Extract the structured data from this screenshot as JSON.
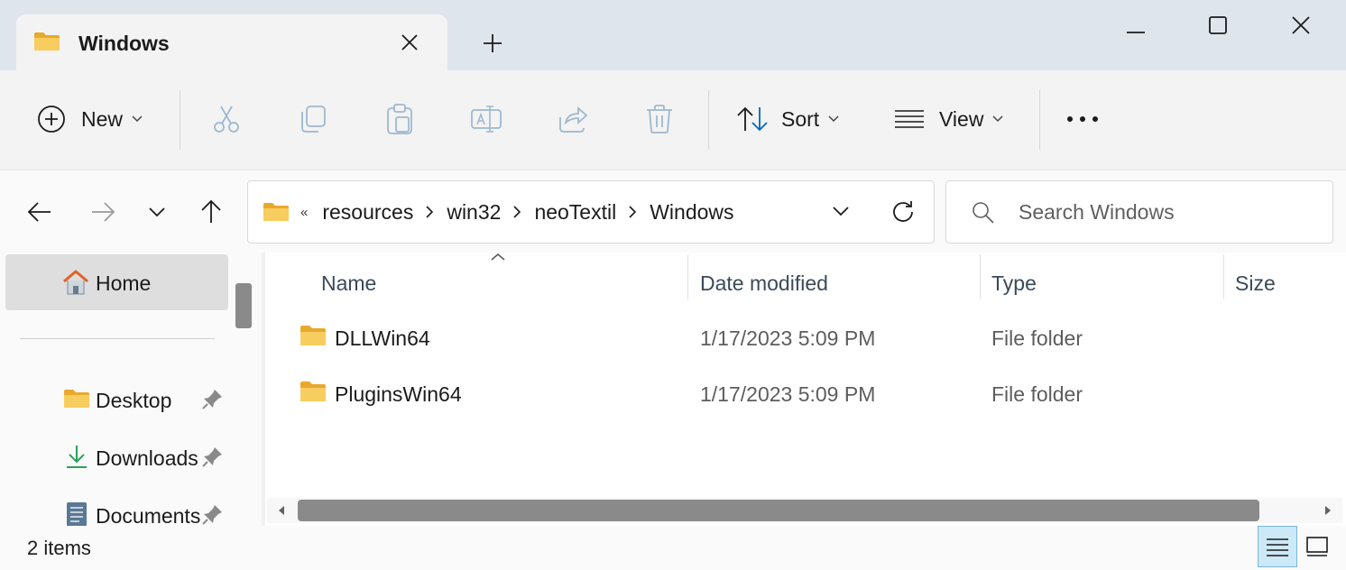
{
  "tab": {
    "title": "Windows"
  },
  "window_controls": {
    "minimize": "minimize-icon",
    "maximize": "maximize-icon",
    "close": "close-icon"
  },
  "command_bar": {
    "new_label": "New",
    "sort_label": "Sort",
    "view_label": "View",
    "icons": [
      "add-circle-icon",
      "cut-icon",
      "copy-icon",
      "paste-icon",
      "rename-icon",
      "share-icon",
      "delete-icon",
      "sort-icon",
      "view-icon",
      "more-icon"
    ]
  },
  "address": {
    "overflow": "«",
    "crumbs": [
      "resources",
      "win32",
      "neoTextil",
      "Windows"
    ]
  },
  "search": {
    "placeholder": "Search Windows"
  },
  "nav_pane": {
    "home": "Home",
    "items": [
      {
        "label": "Desktop",
        "icon": "folder-icon"
      },
      {
        "label": "Downloads",
        "icon": "download-icon"
      },
      {
        "label": "Documents",
        "icon": "document-icon"
      }
    ]
  },
  "columns": {
    "name": "Name",
    "date": "Date modified",
    "type": "Type",
    "size": "Size"
  },
  "rows": [
    {
      "name": "DLLWin64",
      "date": "1/17/2023 5:09 PM",
      "type": "File folder"
    },
    {
      "name": "PluginsWin64",
      "date": "1/17/2023 5:09 PM",
      "type": "File folder"
    }
  ],
  "status": {
    "item_count": "2 items"
  },
  "colors": {
    "folder": "#f7c95c",
    "accent": "#0067c0",
    "home_icon": "#e3622a",
    "selection": "#cde8f7"
  }
}
